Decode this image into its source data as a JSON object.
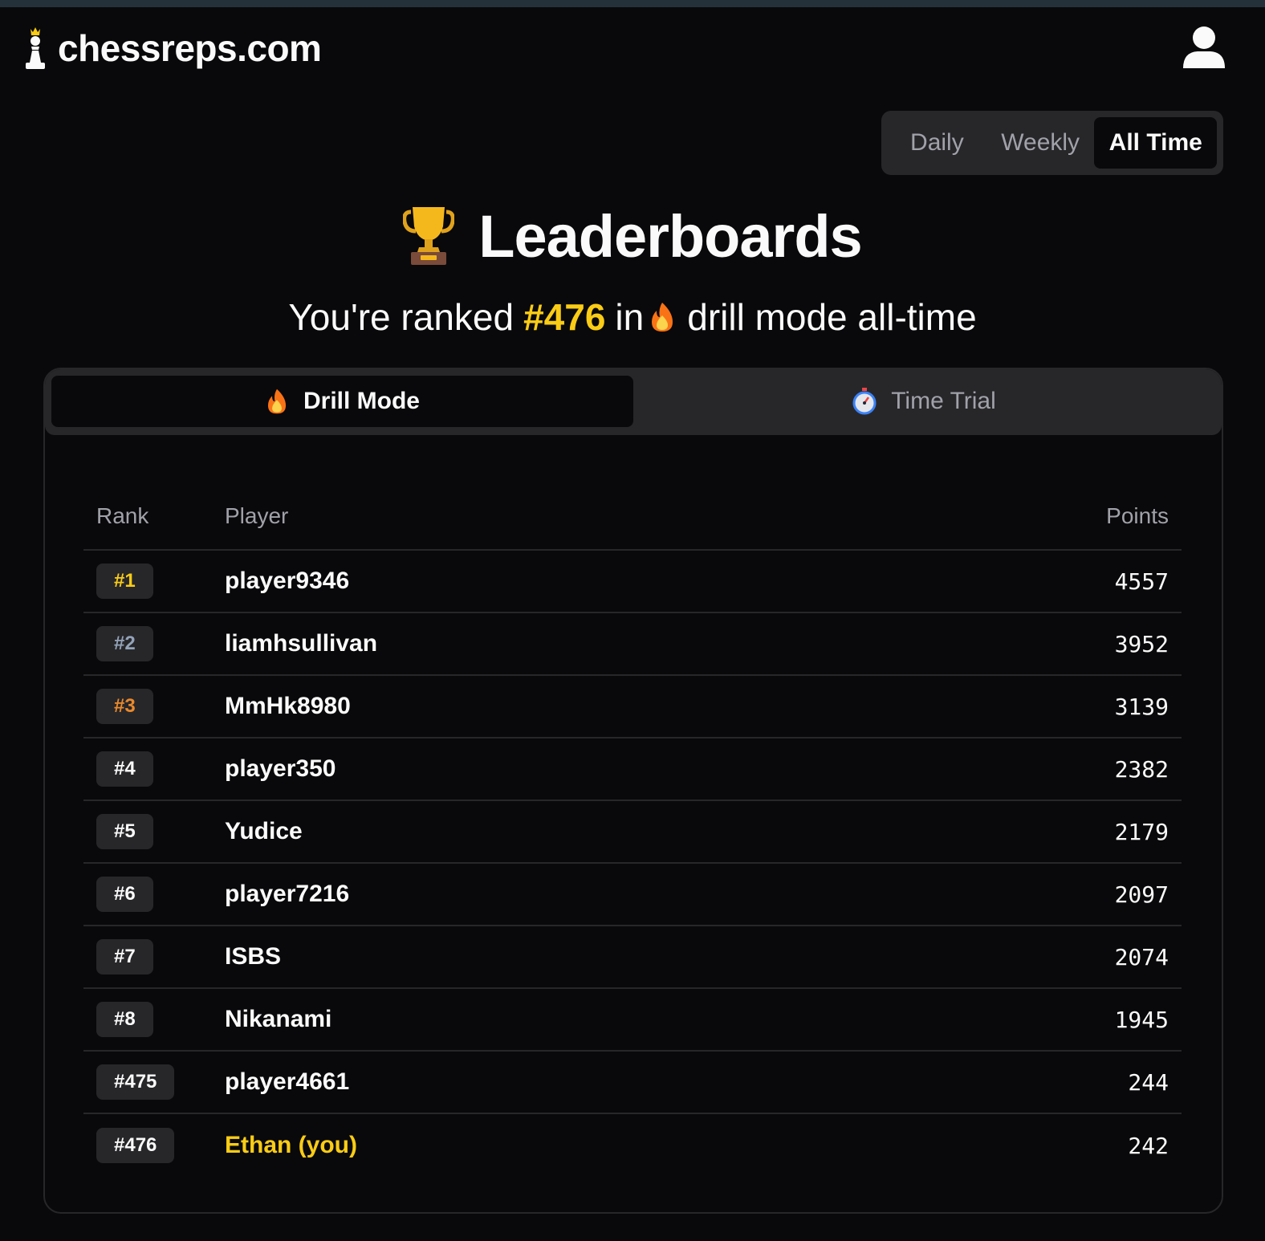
{
  "brand": {
    "name": "chessreps.com",
    "logo_icon": "chess-pawn-crown-icon"
  },
  "header": {
    "user_icon": "user-icon"
  },
  "period_toggle": {
    "options": [
      "Daily",
      "Weekly",
      "All Time"
    ],
    "selected": "All Time"
  },
  "title": {
    "icon": "trophy-icon",
    "text": "Leaderboards"
  },
  "subtitle": {
    "prefix": "You're ranked",
    "rank": "#476",
    "middle": "in",
    "icon": "fire-icon",
    "suffix": "drill mode all-time"
  },
  "mode_tabs": [
    {
      "label": "Drill Mode",
      "icon": "fire-icon",
      "active": true
    },
    {
      "label": "Time Trial",
      "icon": "stopwatch-icon",
      "active": false
    }
  ],
  "table": {
    "headers": {
      "rank": "Rank",
      "player": "Player",
      "points": "Points"
    },
    "rows": [
      {
        "rank": "#1",
        "player": "player9346",
        "points": "4557"
      },
      {
        "rank": "#2",
        "player": "liamhsullivan",
        "points": "3952"
      },
      {
        "rank": "#3",
        "player": "MmHk8980",
        "points": "3139"
      },
      {
        "rank": "#4",
        "player": "player350",
        "points": "2382"
      },
      {
        "rank": "#5",
        "player": "Yudice",
        "points": "2179"
      },
      {
        "rank": "#6",
        "player": "player7216",
        "points": "2097"
      },
      {
        "rank": "#7",
        "player": "ISBS",
        "points": "2074"
      },
      {
        "rank": "#8",
        "player": "Nikanami",
        "points": "1945"
      },
      {
        "rank": "#475",
        "player": "player4661",
        "points": "244"
      },
      {
        "rank": "#476",
        "player": "Ethan (you)",
        "points": "242"
      }
    ]
  },
  "colors": {
    "background": "#09090b",
    "surface": "#27272a",
    "accent_gold": "#facc15",
    "silver": "#94a3b8",
    "bronze": "#ea8a2c",
    "muted_text": "#a1a1aa"
  }
}
